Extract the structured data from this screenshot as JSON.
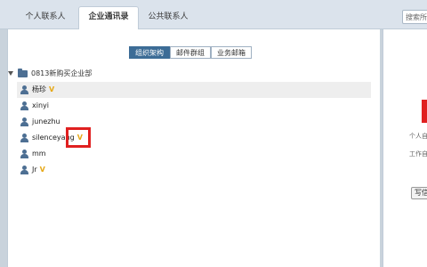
{
  "tabs": [
    {
      "label": "个人联系人",
      "active": false
    },
    {
      "label": "企业通讯录",
      "active": true
    },
    {
      "label": "公共联系人",
      "active": false
    }
  ],
  "search": {
    "text": "搜索所"
  },
  "segments": [
    {
      "label": "组织架构",
      "active": true
    },
    {
      "label": "邮件群组",
      "active": false
    },
    {
      "label": "业务邮箱",
      "active": false
    }
  ],
  "tree": {
    "root": "0813新购买企业部",
    "members": [
      {
        "name": "杨珍",
        "vip": "V"
      },
      {
        "name": "xinyi",
        "vip": ""
      },
      {
        "name": "junezhu",
        "vip": ""
      },
      {
        "name": "silenceyang",
        "vip": "V"
      },
      {
        "name": "mm",
        "vip": ""
      },
      {
        "name": "Jr",
        "vip": "V"
      }
    ]
  },
  "right_panel": {
    "label1": "个人自",
    "label2": "工作自",
    "button": "写信"
  },
  "colors": {
    "accent": "#3c6c96",
    "highlight": "#e02020",
    "vip": "#e6a817"
  }
}
